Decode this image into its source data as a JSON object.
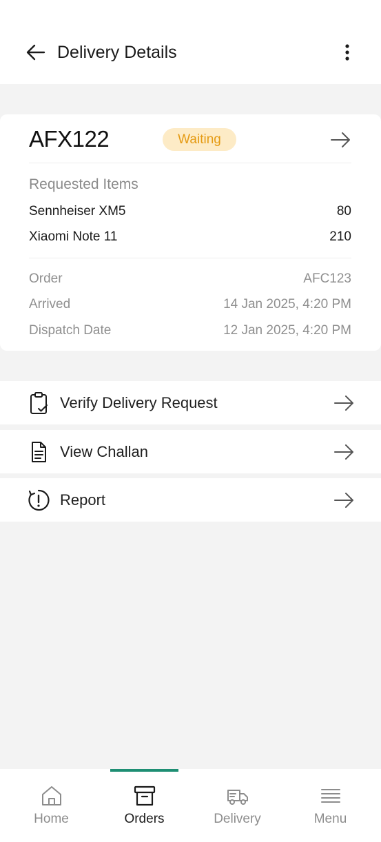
{
  "header": {
    "title": "Delivery Details"
  },
  "card": {
    "order_id": "AFX122",
    "status": "Waiting",
    "requested_items_title": "Requested Items",
    "items": [
      {
        "name": "Sennheiser XM5",
        "qty": "80"
      },
      {
        "name": "Xiaomi Note 11",
        "qty": "210"
      }
    ],
    "meta": [
      {
        "label": "Order",
        "value": "AFC123"
      },
      {
        "label": "Arrived",
        "value": "14 Jan 2025, 4:20 PM"
      },
      {
        "label": "Dispatch Date",
        "value": "12 Jan 2025, 4:20 PM"
      }
    ]
  },
  "actions": [
    {
      "label": "Verify Delivery Request",
      "icon": "clipboard-check-icon"
    },
    {
      "label": "View Challan",
      "icon": "document-icon"
    },
    {
      "label": "Report",
      "icon": "report-alert-icon"
    }
  ],
  "bottom_nav": {
    "active": "Orders",
    "items": [
      {
        "label": "Home",
        "icon": "home-icon"
      },
      {
        "label": "Orders",
        "icon": "archive-box-icon"
      },
      {
        "label": "Delivery",
        "icon": "delivery-truck-icon"
      },
      {
        "label": "Menu",
        "icon": "menu-lines-icon"
      }
    ]
  },
  "colors": {
    "accent": "#1e8e73",
    "status_bg": "#fdebc6",
    "status_text": "#e59b14",
    "background": "#f3f3f3"
  }
}
